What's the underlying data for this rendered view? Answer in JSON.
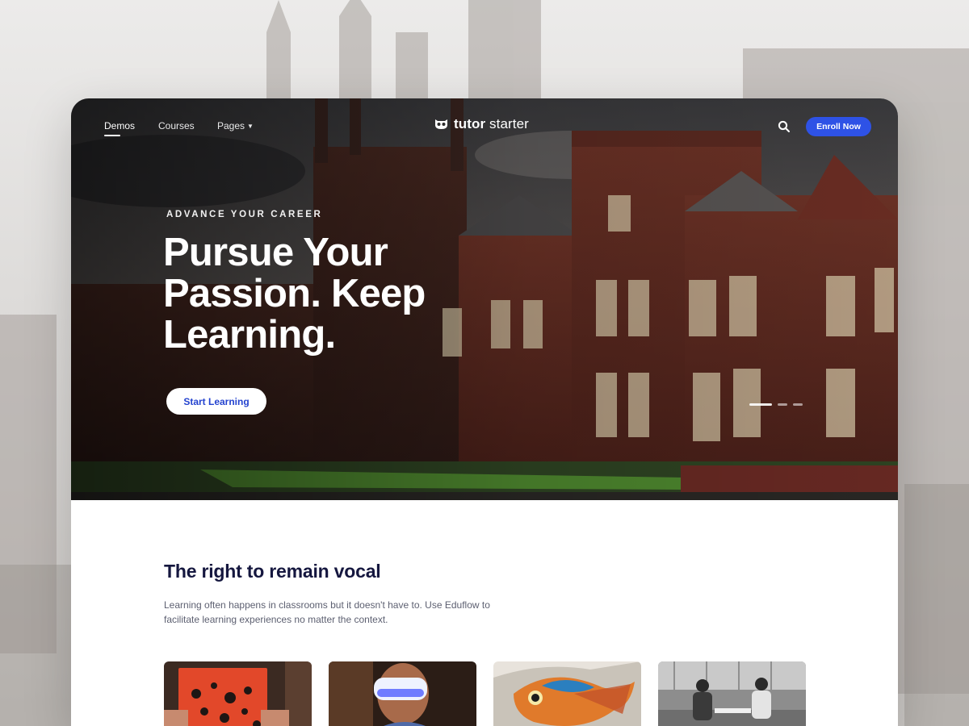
{
  "nav": {
    "items": [
      {
        "label": "Demos",
        "active": true
      },
      {
        "label": "Courses"
      },
      {
        "label": "Pages"
      }
    ],
    "logo_text_bold": "tutor",
    "logo_text": " starter",
    "logo_icon": "owl-icon",
    "search_icon": "search-icon",
    "enroll_label": "Enroll Now"
  },
  "hero": {
    "eyebrow": "ADVANCE YOUR CAREER",
    "headline": "Pursue Your Passion. Keep Learning.",
    "cta_label": "Start Learning",
    "slides": {
      "count": 3,
      "active_index": 0
    }
  },
  "section": {
    "title": "The right to remain vocal",
    "description": "Learning often happens in classrooms but it doesn't have to. Use Eduflow to facilitate learning experiences no matter the context.",
    "cards": [
      {
        "image": "orange-dotted-book"
      },
      {
        "image": "vr-headset-person"
      },
      {
        "image": "fish-mural"
      },
      {
        "image": "bw-people-at-table"
      }
    ]
  },
  "colors": {
    "brand_blue": "#2e52e6",
    "cta_text": "#2443cf",
    "title_navy": "#15173f",
    "body_gray": "#5d6071"
  }
}
